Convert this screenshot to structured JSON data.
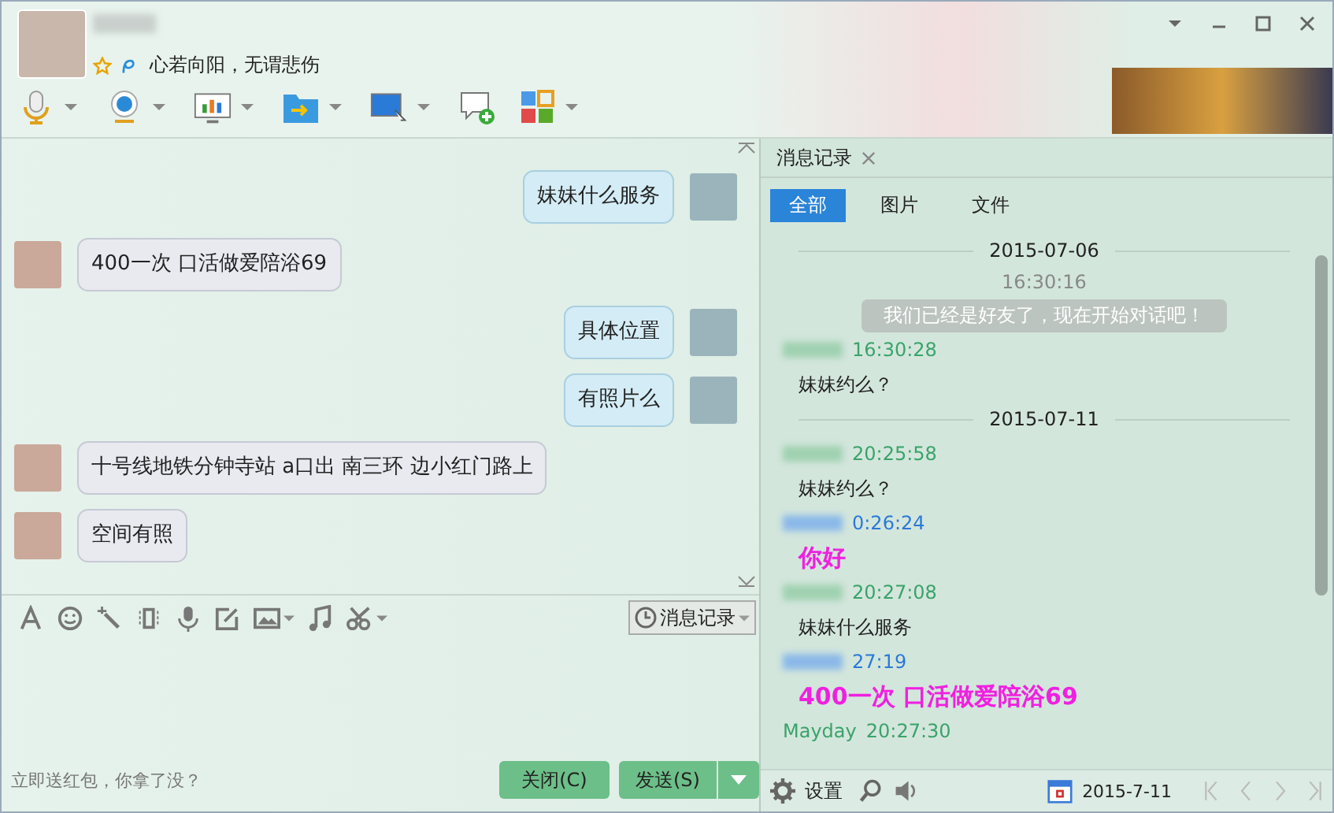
{
  "contact": {
    "signature": "心若向阳，无谓悲伤"
  },
  "chat": {
    "messages": [
      {
        "kind": "sent",
        "text": "妹妹什么服务"
      },
      {
        "kind": "received",
        "text": "400一次 口活做爱陪浴69"
      },
      {
        "kind": "sent",
        "text": "具体位置"
      },
      {
        "kind": "sent",
        "text": "有照片么"
      },
      {
        "kind": "received",
        "text": "十号线地铁分钟寺站 a口出 南三环 边小红门路上"
      },
      {
        "kind": "received",
        "text": "空间有照"
      }
    ]
  },
  "composer": {
    "history_button": "消息记录",
    "promo": "立即送红包，你拿了没？",
    "close_button": "关闭(C)",
    "send_button": "发送(S)"
  },
  "history": {
    "tab": "消息记录",
    "filters": [
      {
        "label": "全部",
        "selected": true
      },
      {
        "label": "图片",
        "selected": false
      },
      {
        "label": "文件",
        "selected": false
      }
    ],
    "entries": [
      {
        "kind": "date",
        "text": "2015-07-06"
      },
      {
        "kind": "system",
        "time": "16:30:16",
        "text": "我们已经是好友了，现在开始对话吧！"
      },
      {
        "kind": "received",
        "time": "16:30:28",
        "text": "妹妹约么？"
      },
      {
        "kind": "date",
        "text": "2015-07-11"
      },
      {
        "kind": "received",
        "time": "20:25:58",
        "text": "妹妹约么？"
      },
      {
        "kind": "sent",
        "time": "0:26:24",
        "text": "你好"
      },
      {
        "kind": "received",
        "time": "20:27:08",
        "text": "妹妹什么服务"
      },
      {
        "kind": "sent",
        "time": "27:19",
        "text": "400一次 口活做爱陪浴69"
      },
      {
        "kind": "received",
        "name": "Mayday",
        "time": "20:27:30"
      }
    ],
    "settings": "设置",
    "date": "2015-7-11"
  }
}
